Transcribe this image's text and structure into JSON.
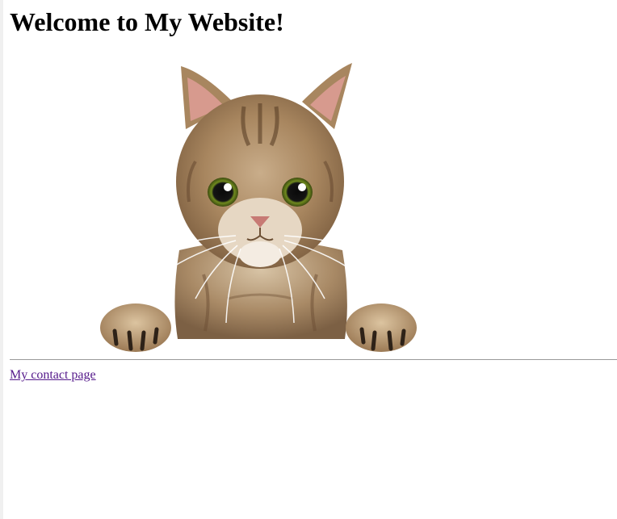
{
  "page": {
    "heading": "Welcome to My Website!",
    "hero_image": {
      "icon": "cat-photo",
      "alt": "Cat peeking over ledge"
    },
    "contact_link": {
      "label": "My contact page",
      "color": "#551a8b"
    }
  },
  "colors": {
    "background": "#ffffff",
    "text": "#000000",
    "visited_link": "#551a8b",
    "divider": "#9a9a9a"
  }
}
